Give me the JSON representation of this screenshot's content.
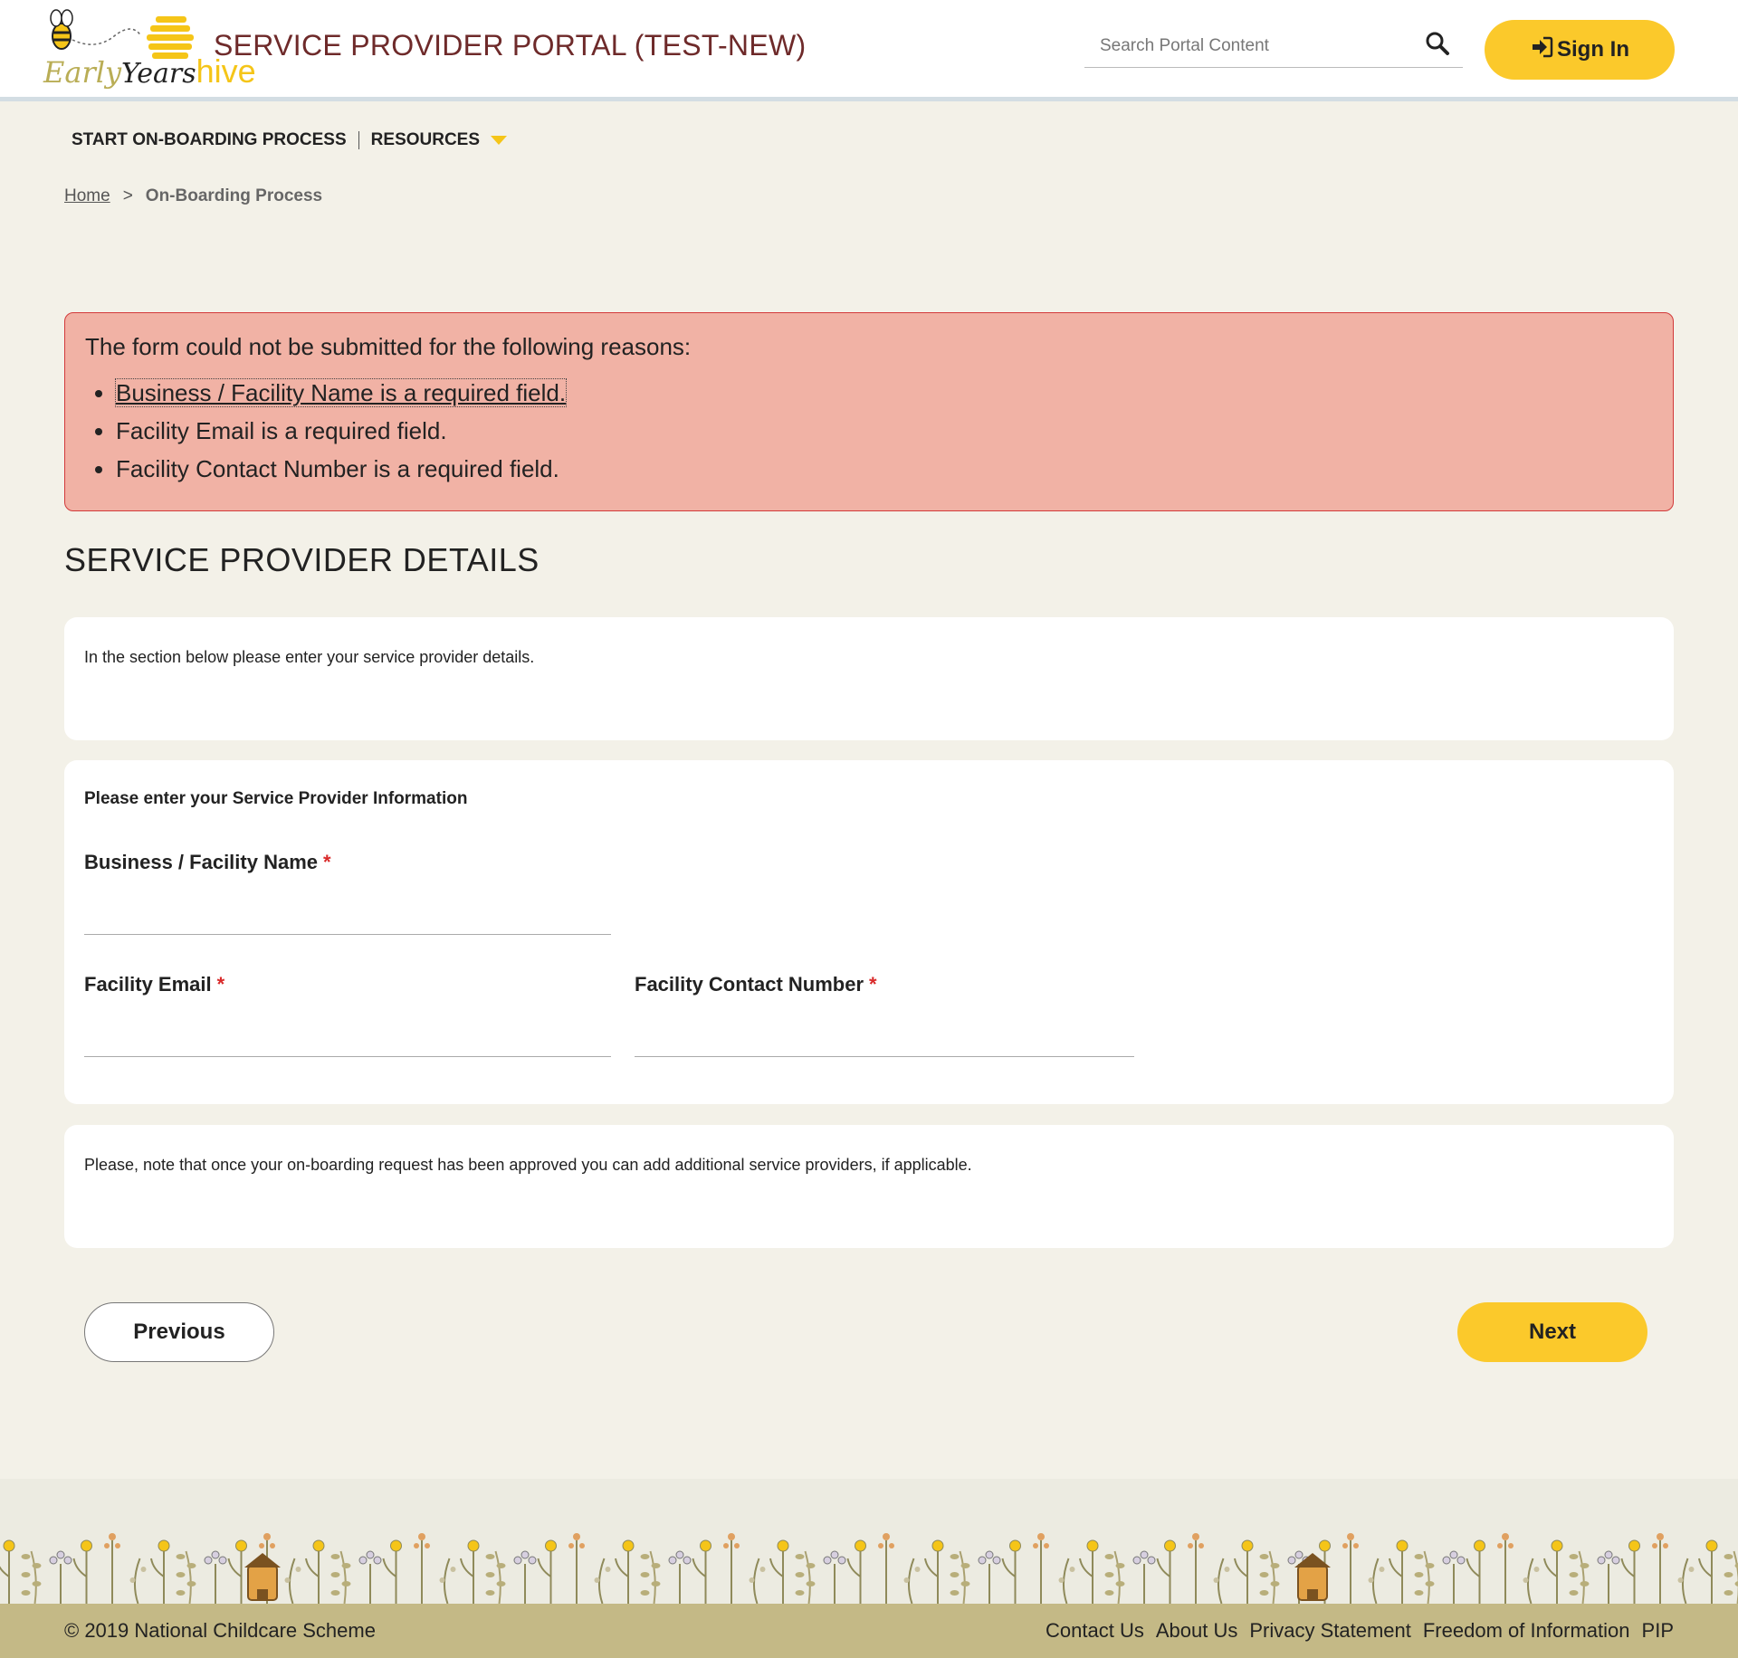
{
  "header": {
    "logo_text": {
      "early": "Early",
      "years": "Years",
      "hive": "hive"
    },
    "portal_title": "SERVICE PROVIDER PORTAL (TEST-NEW)",
    "search_placeholder": "Search Portal Content",
    "search_icon": "search-icon",
    "signin_icon": "sign-in-icon",
    "signin_label": "Sign In"
  },
  "nav": {
    "items": [
      {
        "label": "START ON-BOARDING PROCESS"
      },
      {
        "label": "RESOURCES",
        "has_dropdown": true
      }
    ]
  },
  "breadcrumb": {
    "home": "Home",
    "separator": ">",
    "current": "On-Boarding Process"
  },
  "errors": {
    "lead": "The form could not be submitted for the following reasons:",
    "items": [
      "Business / Facility Name is a required field.",
      "Facility Email is a required field.",
      "Facility Contact Number is a required field."
    ]
  },
  "section_title": "SERVICE PROVIDER DETAILS",
  "intro_note": "In the section below please enter your service provider details.",
  "form": {
    "subheading": "Please enter your Service Provider Information",
    "required_mark": "*",
    "fields": [
      {
        "label": "Business / Facility Name",
        "value": ""
      },
      {
        "label": "Facility Email",
        "value": ""
      },
      {
        "label": "Facility Contact Number",
        "value": ""
      }
    ]
  },
  "bottom_note": "Please, note that once your on-boarding request has been approved you can add additional service providers, if applicable.",
  "buttons": {
    "previous": "Previous",
    "next": "Next"
  },
  "footer": {
    "copyright": "© 2019 National Childcare Scheme",
    "links": [
      "Contact Us",
      "About Us",
      "Privacy Statement",
      "Freedom of Information",
      "PIP"
    ]
  },
  "colors": {
    "accent": "#fbc92b",
    "title": "#6e2a2a",
    "error_bg": "#f1b2a5",
    "error_border": "#d23a3a",
    "footer": "#c4b986"
  }
}
